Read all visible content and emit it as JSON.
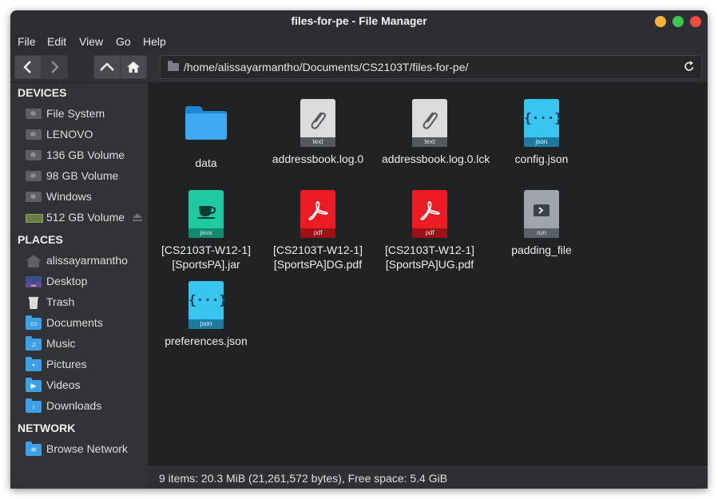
{
  "window": {
    "title": "files-for-pe - File Manager",
    "controls": [
      "minimize",
      "maximize",
      "close"
    ]
  },
  "menu": [
    "File",
    "Edit",
    "View",
    "Go",
    "Help"
  ],
  "toolbar": {
    "path": "/home/alissayarmantho/Documents/CS2103T/files-for-pe/"
  },
  "sidebar": {
    "devices_title": "DEVICES",
    "devices": [
      {
        "label": "File System",
        "icon": "drive-icon"
      },
      {
        "label": "LENOVO",
        "icon": "drive-icon"
      },
      {
        "label": "136 GB Volume",
        "icon": "drive-icon"
      },
      {
        "label": "98 GB Volume",
        "icon": "drive-icon"
      },
      {
        "label": "Windows",
        "icon": "drive-icon"
      },
      {
        "label": "512 GB Volume",
        "icon": "ssd-icon"
      }
    ],
    "places_title": "PLACES",
    "places": [
      {
        "label": "alissayarmantho",
        "icon": "home-icon"
      },
      {
        "label": "Desktop",
        "icon": "desktop-icon"
      },
      {
        "label": "Trash",
        "icon": "trash-icon"
      },
      {
        "label": "Documents",
        "icon": "documents-folder-icon"
      },
      {
        "label": "Music",
        "icon": "music-folder-icon"
      },
      {
        "label": "Pictures",
        "icon": "pictures-folder-icon"
      },
      {
        "label": "Videos",
        "icon": "videos-folder-icon"
      },
      {
        "label": "Downloads",
        "icon": "downloads-folder-icon"
      }
    ],
    "network_title": "NETWORK",
    "network": [
      {
        "label": "Browse Network",
        "icon": "network-folder-icon"
      }
    ]
  },
  "files": [
    {
      "name": "data",
      "type": "folder",
      "icon_label": ""
    },
    {
      "name": "addressbook.log.0",
      "type": "text",
      "icon_label": "text"
    },
    {
      "name": "addressbook.log.0.lck",
      "type": "text",
      "icon_label": "text"
    },
    {
      "name": "config.json",
      "type": "json",
      "icon_label": "json"
    },
    {
      "name": "[CS2103T-W12-1][SportsPA].jar",
      "type": "java",
      "icon_label": "java"
    },
    {
      "name": "[CS2103T-W12-1][SportsPA]DG.pdf",
      "type": "pdf",
      "icon_label": "pdf"
    },
    {
      "name": "[CS2103T-W12-1][SportsPA]UG.pdf",
      "type": "pdf",
      "icon_label": "pdf"
    },
    {
      "name": "padding_file",
      "type": "run",
      "icon_label": "run"
    },
    {
      "name": "preferences.json",
      "type": "json",
      "icon_label": "json"
    }
  ],
  "status": "9 items: 20.3 MiB (21,261,572 bytes), Free space: 5.4 GiB",
  "colors": {
    "window_bg": "#2b2c2f",
    "content_bg": "#212224",
    "folder_blue": "#3ea0e6",
    "json_cyan": "#38c5f0",
    "java_green": "#1fc9a2",
    "pdf_red": "#ec1c24"
  }
}
